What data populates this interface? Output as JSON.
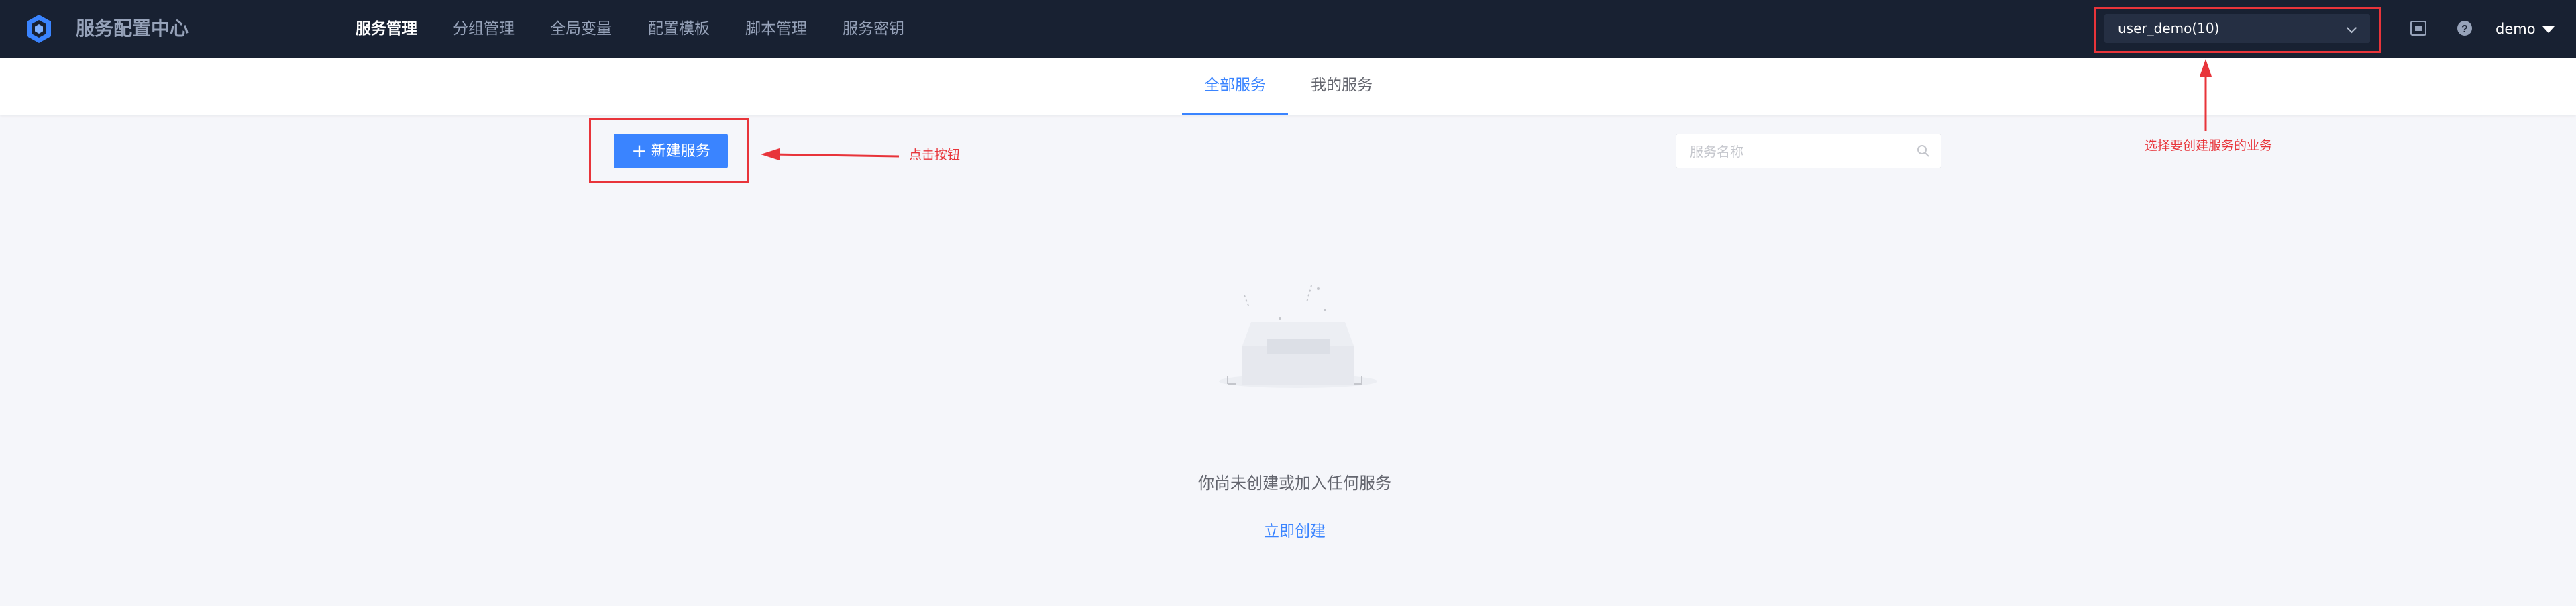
{
  "header": {
    "app_title": "服务配置中心",
    "nav": [
      {
        "label": "服务管理",
        "active": true
      },
      {
        "label": "分组管理",
        "active": false
      },
      {
        "label": "全局变量",
        "active": false
      },
      {
        "label": "配置模板",
        "active": false
      },
      {
        "label": "脚本管理",
        "active": false
      },
      {
        "label": "服务密钥",
        "active": false
      }
    ],
    "business_select": {
      "value": "user_demo(10)"
    },
    "user": {
      "name": "demo"
    },
    "icons": [
      "logo-icon",
      "screen-icon",
      "help-icon",
      "caret-down-icon"
    ]
  },
  "tabs": [
    {
      "label": "全部服务",
      "active": true
    },
    {
      "label": "我的服务",
      "active": false
    }
  ],
  "toolbar": {
    "new_button_label": "新建服务",
    "search_placeholder": "服务名称"
  },
  "empty": {
    "message": "你尚未创建或加入任何服务",
    "create_link": "立即创建"
  },
  "annotations": {
    "click_button": "点击按钮",
    "select_business": "选择要创建服务的业务"
  },
  "colors": {
    "topbar_bg": "#182132",
    "primary": "#3a84ff",
    "annotation": "#e8343a",
    "page_bg": "#f5f6fa"
  }
}
